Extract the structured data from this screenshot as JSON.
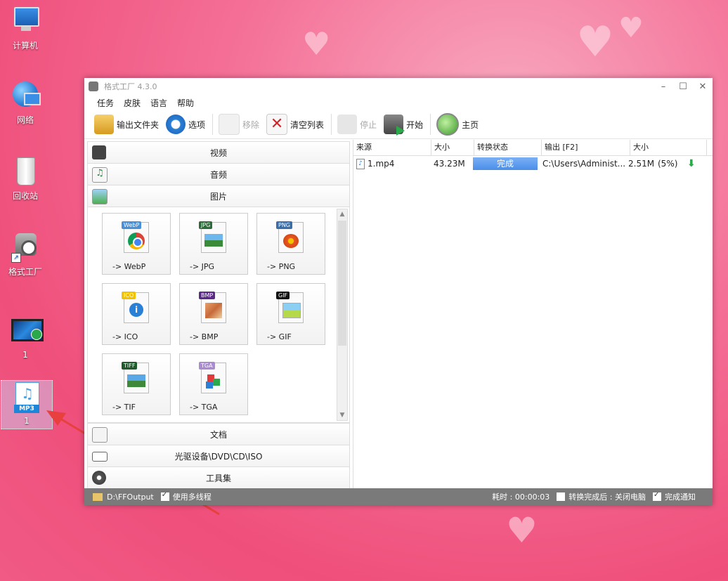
{
  "desktop": {
    "icons": [
      {
        "label": "计算机",
        "icon": "computer-icon"
      },
      {
        "label": "网络",
        "icon": "network-icon"
      },
      {
        "label": "回收站",
        "icon": "recycle-bin-icon"
      },
      {
        "label": "格式工厂",
        "icon": "format-factory-shortcut-icon"
      },
      {
        "label": "1",
        "icon": "video-file-icon"
      },
      {
        "label": "1",
        "icon": "mp3-file-icon",
        "badge": "MP3"
      }
    ]
  },
  "window": {
    "title": "格式工厂 4.3.0",
    "menu": [
      "任务",
      "皮肤",
      "语言",
      "帮助"
    ],
    "toolbar": {
      "output_folder": "输出文件夹",
      "options": "选项",
      "remove": "移除",
      "clear_list": "清空列表",
      "stop": "停止",
      "start": "开始",
      "home": "主页"
    },
    "categories": {
      "video": "视频",
      "audio": "音频",
      "image": "图片",
      "document": "文档",
      "optical": "光驱设备\\DVD\\CD\\ISO",
      "tools": "工具集"
    },
    "formats": [
      {
        "label": "-> WebP",
        "tag": "WebP",
        "color": "#4a90d9"
      },
      {
        "label": "-> JPG",
        "tag": "JPG",
        "color": "#2d6b3a"
      },
      {
        "label": "-> PNG",
        "tag": "PNG",
        "color": "#3b6ea8"
      },
      {
        "label": "-> ICO",
        "tag": "ICO",
        "color": "#f2c200"
      },
      {
        "label": "-> BMP",
        "tag": "BMP",
        "color": "#5b2a86"
      },
      {
        "label": "-> GIF",
        "tag": "GIF",
        "color": "#111111"
      },
      {
        "label": "-> TIF",
        "tag": "TIFF",
        "color": "#1f5a2a"
      },
      {
        "label": "-> TGA",
        "tag": "TGA",
        "color": "#a98ccf"
      }
    ],
    "table": {
      "headers": [
        "来源",
        "大小",
        "转换状态",
        "输出 [F2]",
        "大小"
      ],
      "rows": [
        {
          "source": "1.mp4",
          "size": "43.23M",
          "status": "完成",
          "output": "C:\\Users\\Administ...",
          "out_size": "2.51M",
          "ratio": "(5%)"
        }
      ]
    },
    "statusbar": {
      "folder": "D:\\FFOutput",
      "multithread": "使用多线程",
      "elapsed": "耗时 : 00:00:03",
      "after": "转换完成后 : 关闭电脑",
      "notify": "完成通知"
    }
  },
  "colors": {
    "accent": "#4a8ee8",
    "annotation_arrow": "#e8403f"
  }
}
